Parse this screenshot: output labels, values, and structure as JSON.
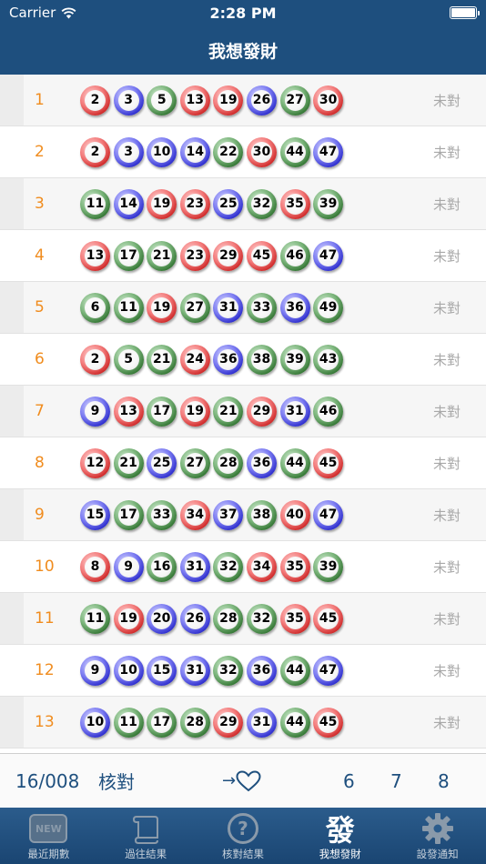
{
  "status_bar": {
    "carrier": "Carrier",
    "time": "2:28 PM"
  },
  "header": {
    "title": "我想發財"
  },
  "rows": [
    {
      "index": "1",
      "status": "未對",
      "balls": [
        [
          "2",
          "red"
        ],
        [
          "3",
          "blue"
        ],
        [
          "5",
          "green"
        ],
        [
          "13",
          "red"
        ],
        [
          "19",
          "red"
        ],
        [
          "26",
          "blue"
        ],
        [
          "27",
          "green"
        ],
        [
          "30",
          "red"
        ]
      ]
    },
    {
      "index": "2",
      "status": "未對",
      "balls": [
        [
          "2",
          "red"
        ],
        [
          "3",
          "blue"
        ],
        [
          "10",
          "blue"
        ],
        [
          "14",
          "blue"
        ],
        [
          "22",
          "green"
        ],
        [
          "30",
          "red"
        ],
        [
          "44",
          "green"
        ],
        [
          "47",
          "blue"
        ]
      ]
    },
    {
      "index": "3",
      "status": "未對",
      "balls": [
        [
          "11",
          "green"
        ],
        [
          "14",
          "blue"
        ],
        [
          "19",
          "red"
        ],
        [
          "23",
          "red"
        ],
        [
          "25",
          "blue"
        ],
        [
          "32",
          "green"
        ],
        [
          "35",
          "red"
        ],
        [
          "39",
          "green"
        ]
      ]
    },
    {
      "index": "4",
      "status": "未對",
      "balls": [
        [
          "13",
          "red"
        ],
        [
          "17",
          "green"
        ],
        [
          "21",
          "green"
        ],
        [
          "23",
          "red"
        ],
        [
          "29",
          "red"
        ],
        [
          "45",
          "red"
        ],
        [
          "46",
          "green"
        ],
        [
          "47",
          "blue"
        ]
      ]
    },
    {
      "index": "5",
      "status": "未對",
      "balls": [
        [
          "6",
          "green"
        ],
        [
          "11",
          "green"
        ],
        [
          "19",
          "red"
        ],
        [
          "27",
          "green"
        ],
        [
          "31",
          "blue"
        ],
        [
          "33",
          "green"
        ],
        [
          "36",
          "blue"
        ],
        [
          "49",
          "green"
        ]
      ]
    },
    {
      "index": "6",
      "status": "未對",
      "balls": [
        [
          "2",
          "red"
        ],
        [
          "5",
          "green"
        ],
        [
          "21",
          "green"
        ],
        [
          "24",
          "red"
        ],
        [
          "36",
          "blue"
        ],
        [
          "38",
          "green"
        ],
        [
          "39",
          "green"
        ],
        [
          "43",
          "green"
        ]
      ]
    },
    {
      "index": "7",
      "status": "未對",
      "balls": [
        [
          "9",
          "blue"
        ],
        [
          "13",
          "red"
        ],
        [
          "17",
          "green"
        ],
        [
          "19",
          "red"
        ],
        [
          "21",
          "green"
        ],
        [
          "29",
          "red"
        ],
        [
          "31",
          "blue"
        ],
        [
          "46",
          "green"
        ]
      ]
    },
    {
      "index": "8",
      "status": "未對",
      "balls": [
        [
          "12",
          "red"
        ],
        [
          "21",
          "green"
        ],
        [
          "25",
          "blue"
        ],
        [
          "27",
          "green"
        ],
        [
          "28",
          "green"
        ],
        [
          "36",
          "blue"
        ],
        [
          "44",
          "green"
        ],
        [
          "45",
          "red"
        ]
      ]
    },
    {
      "index": "9",
      "status": "未對",
      "balls": [
        [
          "15",
          "blue"
        ],
        [
          "17",
          "green"
        ],
        [
          "33",
          "green"
        ],
        [
          "34",
          "red"
        ],
        [
          "37",
          "blue"
        ],
        [
          "38",
          "green"
        ],
        [
          "40",
          "red"
        ],
        [
          "47",
          "blue"
        ]
      ]
    },
    {
      "index": "10",
      "status": "未對",
      "balls": [
        [
          "8",
          "red"
        ],
        [
          "9",
          "blue"
        ],
        [
          "16",
          "green"
        ],
        [
          "31",
          "blue"
        ],
        [
          "32",
          "green"
        ],
        [
          "34",
          "red"
        ],
        [
          "35",
          "red"
        ],
        [
          "39",
          "green"
        ]
      ]
    },
    {
      "index": "11",
      "status": "未對",
      "balls": [
        [
          "11",
          "green"
        ],
        [
          "19",
          "red"
        ],
        [
          "20",
          "blue"
        ],
        [
          "26",
          "blue"
        ],
        [
          "28",
          "green"
        ],
        [
          "32",
          "green"
        ],
        [
          "35",
          "red"
        ],
        [
          "45",
          "red"
        ]
      ]
    },
    {
      "index": "12",
      "status": "未對",
      "balls": [
        [
          "9",
          "blue"
        ],
        [
          "10",
          "blue"
        ],
        [
          "15",
          "blue"
        ],
        [
          "31",
          "blue"
        ],
        [
          "32",
          "green"
        ],
        [
          "36",
          "blue"
        ],
        [
          "44",
          "green"
        ],
        [
          "47",
          "blue"
        ]
      ]
    },
    {
      "index": "13",
      "status": "未對",
      "balls": [
        [
          "10",
          "blue"
        ],
        [
          "11",
          "green"
        ],
        [
          "17",
          "green"
        ],
        [
          "28",
          "green"
        ],
        [
          "29",
          "red"
        ],
        [
          "31",
          "blue"
        ],
        [
          "44",
          "green"
        ],
        [
          "45",
          "red"
        ]
      ]
    }
  ],
  "footer": {
    "period": "16/008",
    "check_label": "核對",
    "arrow": "→",
    "counts": [
      "6",
      "7",
      "8"
    ]
  },
  "tabs": [
    {
      "label": "最近期數",
      "icon": "new-icon",
      "icon_text": "NEW",
      "active": false
    },
    {
      "label": "過往結果",
      "icon": "scroll-icon",
      "icon_text": "",
      "active": false
    },
    {
      "label": "核對結果",
      "icon": "question-icon",
      "icon_text": "?",
      "active": false
    },
    {
      "label": "我想發財",
      "icon": "fa-character-icon",
      "icon_text": "發",
      "active": true
    },
    {
      "label": "設發通知",
      "icon": "gear-icon",
      "icon_text": "",
      "active": false
    }
  ],
  "colors": {
    "header_bg": "#1e4f7e",
    "row_number": "#f08c1e",
    "status_text": "#a8a8a8",
    "footer_text": "#1e4f7e"
  }
}
